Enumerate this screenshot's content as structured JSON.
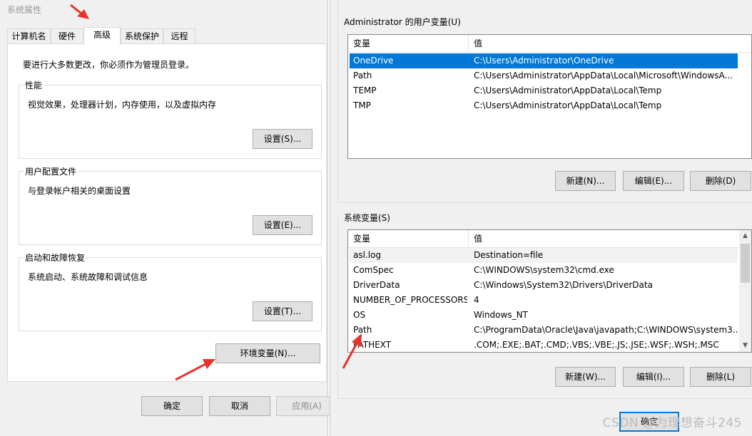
{
  "sysprops": {
    "title": "系统属性",
    "tabs": [
      "计算机名",
      "硬件",
      "高级",
      "系统保护",
      "远程"
    ],
    "admin_notice": "要进行大多数更改，你必须作为管理员登录。",
    "groups": [
      {
        "label": "性能",
        "desc": "视觉效果，处理器计划，内存使用，以及虚拟内存",
        "button": "设置(S)..."
      },
      {
        "label": "用户配置文件",
        "desc": "与登录帐户相关的桌面设置",
        "button": "设置(E)..."
      },
      {
        "label": "启动和故障恢复",
        "desc": "系统启动、系统故障和调试信息",
        "button": "设置(T)..."
      }
    ],
    "env_button": "环境变量(N)...",
    "footer": {
      "ok": "确定",
      "cancel": "取消",
      "apply": "应用(A)"
    }
  },
  "envvars": {
    "user_section_label": "Administrator 的用户变量(U)",
    "user_columns": [
      "变量",
      "值"
    ],
    "user_vars": [
      {
        "name": "OneDrive",
        "value": "C:\\Users\\Administrator\\OneDrive"
      },
      {
        "name": "Path",
        "value": "C:\\Users\\Administrator\\AppData\\Local\\Microsoft\\WindowsA..."
      },
      {
        "name": "TEMP",
        "value": "C:\\Users\\Administrator\\AppData\\Local\\Temp"
      },
      {
        "name": "TMP",
        "value": "C:\\Users\\Administrator\\AppData\\Local\\Temp"
      }
    ],
    "user_buttons": {
      "new": "新建(N)...",
      "edit": "编辑(E)...",
      "delete": "删除(D)"
    },
    "system_section_label": "系统变量(S)",
    "system_columns": [
      "变量",
      "值"
    ],
    "system_vars": [
      {
        "name": "asl.log",
        "value": "Destination=file"
      },
      {
        "name": "ComSpec",
        "value": "C:\\WINDOWS\\system32\\cmd.exe"
      },
      {
        "name": "DriverData",
        "value": "C:\\Windows\\System32\\Drivers\\DriverData"
      },
      {
        "name": "NUMBER_OF_PROCESSORS",
        "value": "4"
      },
      {
        "name": "OS",
        "value": "Windows_NT"
      },
      {
        "name": "Path",
        "value": "C:\\ProgramData\\Oracle\\Java\\javapath;C:\\WINDOWS\\system3..."
      },
      {
        "name": "PATHEXT",
        "value": ".COM;.EXE;.BAT;.CMD;.VBS;.VBE;.JS;.JSE;.WSF;.WSH;.MSC"
      }
    ],
    "system_buttons": {
      "new": "新建(W)...",
      "edit": "编辑(I)...",
      "delete": "删除(L)"
    },
    "footer": {
      "ok": "确定"
    }
  },
  "watermark": "CSDN @为理想奋斗245",
  "colors": {
    "selection": "#0078d7",
    "annotation_arrow": "#e8322b"
  }
}
